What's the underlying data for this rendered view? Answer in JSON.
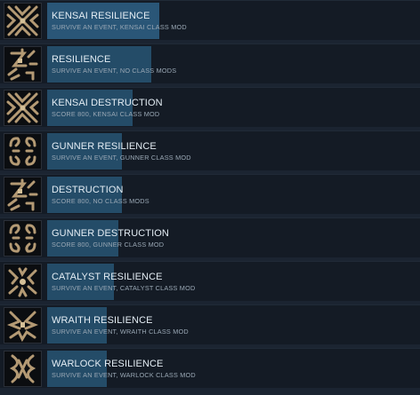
{
  "achievements": [
    {
      "title": "KENSAI RESILIENCE",
      "description": "SURVIVE AN EVENT, KENSAI CLASS MOD",
      "progress": 0.3,
      "icon": "kensai-emblem-icon"
    },
    {
      "title": "RESILIENCE",
      "description": "SURVIVE AN EVENT, NO CLASS MODS",
      "progress": 0.28,
      "icon": "no-class-emblem-icon"
    },
    {
      "title": "KENSAI DESTRUCTION",
      "description": "SCORE 800, KENSAI CLASS MOD",
      "progress": 0.23,
      "icon": "kensai-emblem-icon"
    },
    {
      "title": "GUNNER RESILIENCE",
      "description": "SURVIVE AN EVENT, GUNNER CLASS MOD",
      "progress": 0.2,
      "icon": "gunner-emblem-icon"
    },
    {
      "title": "DESTRUCTION",
      "description": "SCORE 800, NO CLASS MODS",
      "progress": 0.2,
      "icon": "no-class-emblem-icon"
    },
    {
      "title": "GUNNER DESTRUCTION",
      "description": "SCORE 800, GUNNER CLASS MOD",
      "progress": 0.19,
      "icon": "gunner-emblem-icon"
    },
    {
      "title": "CATALYST RESILIENCE",
      "description": "SURVIVE AN EVENT, CATALYST CLASS MOD",
      "progress": 0.18,
      "icon": "catalyst-emblem-icon"
    },
    {
      "title": "WRAITH RESILIENCE",
      "description": "SURVIVE AN EVENT, WRAITH CLASS MOD",
      "progress": 0.16,
      "icon": "wraith-emblem-icon"
    },
    {
      "title": "WARLOCK RESILIENCE",
      "description": "SURVIVE AN EVENT, WARLOCK CLASS MOD",
      "progress": 0.16,
      "icon": "warlock-emblem-icon"
    }
  ],
  "colors": {
    "progress_bar": "#244c68",
    "row_background": "#141b25",
    "title_text": "#e4edf4",
    "description_text": "#9aa8b5"
  }
}
